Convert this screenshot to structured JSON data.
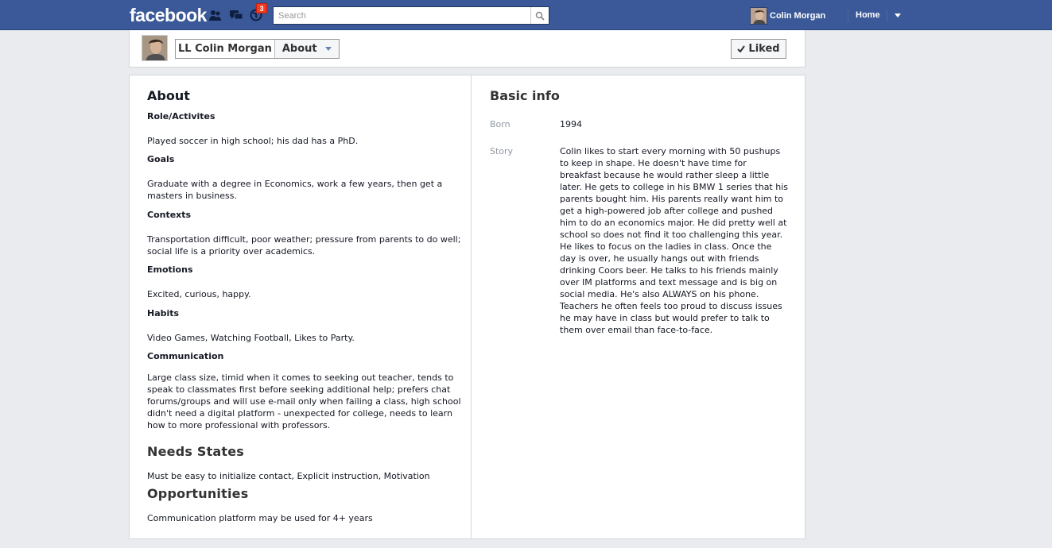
{
  "topbar": {
    "logo": "facebook",
    "notifications_count": "3",
    "search_placeholder": "Search",
    "user_name": "Colin Morgan",
    "home_label": "Home"
  },
  "page_header": {
    "page_name": "LL Colin Morgan",
    "section_label": "About",
    "liked_label": "Liked"
  },
  "about": {
    "title": "About",
    "sections": [
      {
        "heading": "Role/Activites",
        "text": "Played soccer in high school; his dad has a PhD."
      },
      {
        "heading": "Goals",
        "text": "Graduate with a degree in Economics, work a few years, then get a masters in business."
      },
      {
        "heading": "Contexts",
        "text": "Transportation difficult, poor weather; pressure from parents to do well; social life is a priority over academics."
      },
      {
        "heading": "Emotions",
        "text": "Excited, curious, happy."
      },
      {
        "heading": "Habits",
        "text": "Video Games, Watching Football, Likes to Party."
      },
      {
        "heading": "Communication",
        "text": "Large class size, timid when it comes to seeking out teacher, tends to speak to classmates first before seeking additional help; prefers chat forums/groups and will use e-mail only when failing a class, high school didn't need a digital platform - unexpected for college, needs to learn how to more professional with professors."
      }
    ],
    "needs_title": "Needs States",
    "needs_text": "Must be easy to initialize contact, Explicit instruction, Motivation",
    "opportunities_title": "Opportunities",
    "opportunities_text": "Communication platform may be used for 4+ years"
  },
  "basic_info": {
    "title": "Basic info",
    "born_label": "Born",
    "born_value": "1994",
    "story_label": "Story",
    "story_value": "Colin likes to start every morning with 50 pushups to keep in shape. He doesn't have time for breakfast because he would rather sleep a little later. He gets to college in his BMW 1 series that his parents bought him. His parents really want him to get a high-powered job after college and pushed him to do an economics major. He did pretty well at school so does not find it too challenging this year. He likes to focus on the ladies in class. Once the day is over, he usually hangs out with friends drinking Coors beer. He talks to his friends mainly over IM platforms and text message and is big on social media. He's also ALWAYS on his phone. Teachers he often feels too proud to discuss issues he may have in class but would prefer to talk to them over email than face-to-face."
  },
  "colors": {
    "topbar": "#3b5998",
    "badge": "#f03d25",
    "background": "#e9ebee"
  },
  "icons": [
    "friend-requests-icon",
    "messages-icon",
    "notifications-globe-icon",
    "search-icon",
    "check-icon",
    "dropdown-arrow-icon"
  ]
}
